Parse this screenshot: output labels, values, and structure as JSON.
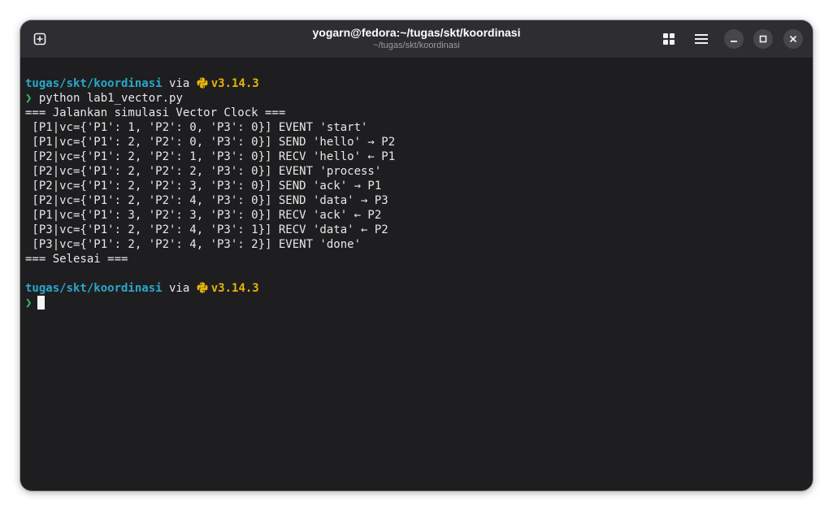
{
  "window": {
    "title": "yogarn@fedora:~/tugas/skt/koordinasi",
    "subtitle": "~/tugas/skt/koordinasi"
  },
  "prompt1": {
    "dir": "tugas/skt/koordinasi",
    "via": " via ",
    "version": "v3.14.3",
    "symbol": "❯",
    "command": " python lab1_vector.py"
  },
  "output": [
    "=== Jalankan simulasi Vector Clock ===",
    " [P1|vc={'P1': 1, 'P2': 0, 'P3': 0}] EVENT 'start'",
    " [P1|vc={'P1': 2, 'P2': 0, 'P3': 0}] SEND 'hello' → P2",
    " [P2|vc={'P1': 2, 'P2': 1, 'P3': 0}] RECV 'hello' ← P1",
    " [P2|vc={'P1': 2, 'P2': 2, 'P3': 0}] EVENT 'process'",
    " [P2|vc={'P1': 2, 'P2': 3, 'P3': 0}] SEND 'ack' → P1",
    " [P2|vc={'P1': 2, 'P2': 4, 'P3': 0}] SEND 'data' → P3",
    " [P1|vc={'P1': 3, 'P2': 3, 'P3': 0}] RECV 'ack' ← P2",
    " [P3|vc={'P1': 2, 'P2': 4, 'P3': 1}] RECV 'data' ← P2",
    " [P3|vc={'P1': 2, 'P2': 4, 'P3': 2}] EVENT 'done'",
    "=== Selesai ==="
  ],
  "prompt2": {
    "dir": "tugas/skt/koordinasi",
    "via": " via ",
    "version": "v3.14.3",
    "symbol": "❯"
  },
  "colors": {
    "directory": "#2aa7c9",
    "version": "#e6b30a",
    "prompt_symbol": "#33c16b",
    "background": "#1e1e20",
    "titlebar": "#2e2e32"
  },
  "icons": {
    "new_tab": "new-tab-icon",
    "grid": "grid-icon",
    "menu": "hamburger-menu-icon",
    "minimize": "minimize-icon",
    "maximize": "maximize-icon",
    "close": "close-icon",
    "python": "python-icon"
  }
}
